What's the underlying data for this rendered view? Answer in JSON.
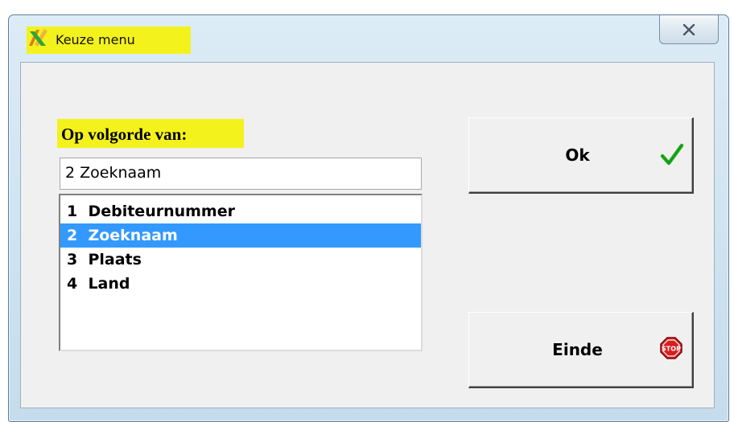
{
  "window": {
    "title": "Keuze menu",
    "icon": "app-icon",
    "close_icon": "close-icon"
  },
  "form": {
    "section_label": "Op volgorde van:",
    "selected_value": "2  Zoeknaam",
    "options": [
      {
        "label": "1  Debiteurnummer",
        "selected": false
      },
      {
        "label": "2  Zoeknaam",
        "selected": true
      },
      {
        "label": "3  Plaats",
        "selected": false
      },
      {
        "label": "4  Land",
        "selected": false
      }
    ]
  },
  "buttons": {
    "ok_label": "Ok",
    "ok_icon": "checkmark-icon",
    "einde_label": "Einde",
    "einde_icon": "stop-sign-icon"
  },
  "colors": {
    "highlight": "#f4f21c",
    "selection": "#3399ff",
    "check": "#22b022",
    "stop": "#d81e1e"
  }
}
